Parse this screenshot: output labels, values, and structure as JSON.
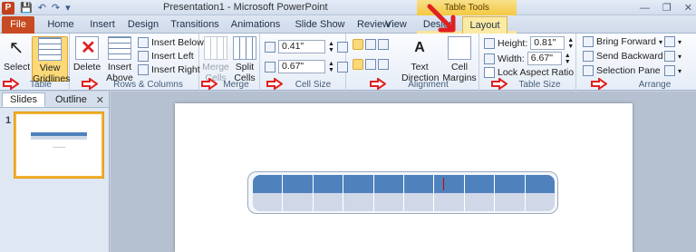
{
  "titlebar": {
    "app_icon": "P",
    "title": "Presentation1  -  Microsoft PowerPoint",
    "contextual_header": "Table Tools"
  },
  "tabs": [
    {
      "label": "File"
    },
    {
      "label": "Home"
    },
    {
      "label": "Insert"
    },
    {
      "label": "Design"
    },
    {
      "label": "Transitions"
    },
    {
      "label": "Animations"
    },
    {
      "label": "Slide Show"
    },
    {
      "label": "Review"
    },
    {
      "label": "View"
    },
    {
      "label": "Design"
    },
    {
      "label": "Layout"
    }
  ],
  "ribbon": {
    "table_group": {
      "label": "Table",
      "select": "Select",
      "view_gridlines_1": "View",
      "view_gridlines_2": "Gridlines"
    },
    "rows_cols_group": {
      "label": "Rows & Columns",
      "delete": "Delete",
      "insert_above_1": "Insert",
      "insert_above_2": "Above",
      "insert_below": "Insert Below",
      "insert_left": "Insert Left",
      "insert_right": "Insert Right"
    },
    "merge_group": {
      "label": "Merge",
      "merge_cells_1": "Merge",
      "merge_cells_2": "Cells",
      "split_cells_1": "Split",
      "split_cells_2": "Cells"
    },
    "cell_size_group": {
      "label": "Cell Size",
      "height": "0.41\"",
      "width": "0.67\""
    },
    "alignment_group": {
      "label": "Alignment",
      "text_direction_1": "Text",
      "text_direction_2": "Direction",
      "cell_margins_1": "Cell",
      "cell_margins_2": "Margins"
    },
    "table_size_group": {
      "label": "Table Size",
      "height_label": "Height:",
      "height_value": "0.81\"",
      "width_label": "Width:",
      "width_value": "6.67\"",
      "lock_aspect": "Lock Aspect Ratio"
    },
    "arrange_group": {
      "label": "Arrange",
      "bring_forward": "Bring Forward",
      "send_backward": "Send Backward",
      "selection_pane": "Selection Pane"
    }
  },
  "left_pane": {
    "tab_slides": "Slides",
    "tab_outline": "Outline",
    "close": "✕",
    "slide_number": "1"
  },
  "colors": {
    "accent_file": "#c84a22",
    "contextual_tab": "#fbe59e",
    "table_header": "#4f81bd",
    "table_body": "#d0d8e8",
    "marker_red": "#e02020"
  }
}
